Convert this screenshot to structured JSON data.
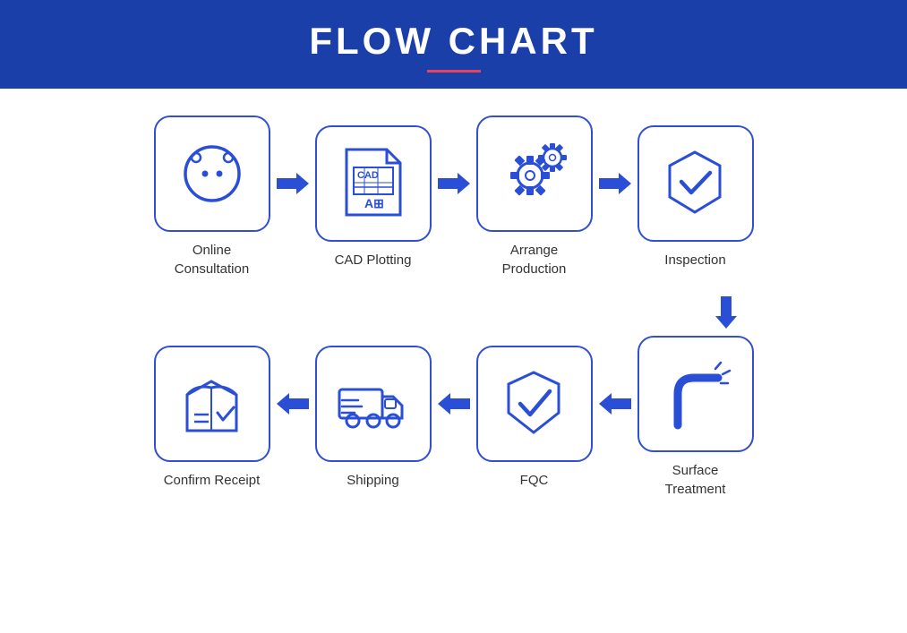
{
  "header": {
    "title": "FLOW CHART"
  },
  "steps": {
    "row1": [
      {
        "id": "online-consultation",
        "label": "Online\nConsultation"
      },
      {
        "id": "cad-plotting",
        "label": "CAD Plotting"
      },
      {
        "id": "arrange-production",
        "label": "Arrange\nProduction"
      },
      {
        "id": "inspection",
        "label": "Inspection"
      }
    ],
    "row2": [
      {
        "id": "confirm-receipt",
        "label": "Confirm Receipt"
      },
      {
        "id": "shipping",
        "label": "Shipping"
      },
      {
        "id": "fqc",
        "label": "FQC"
      },
      {
        "id": "surface-treatment",
        "label": "Surface\nTreatment"
      }
    ]
  }
}
